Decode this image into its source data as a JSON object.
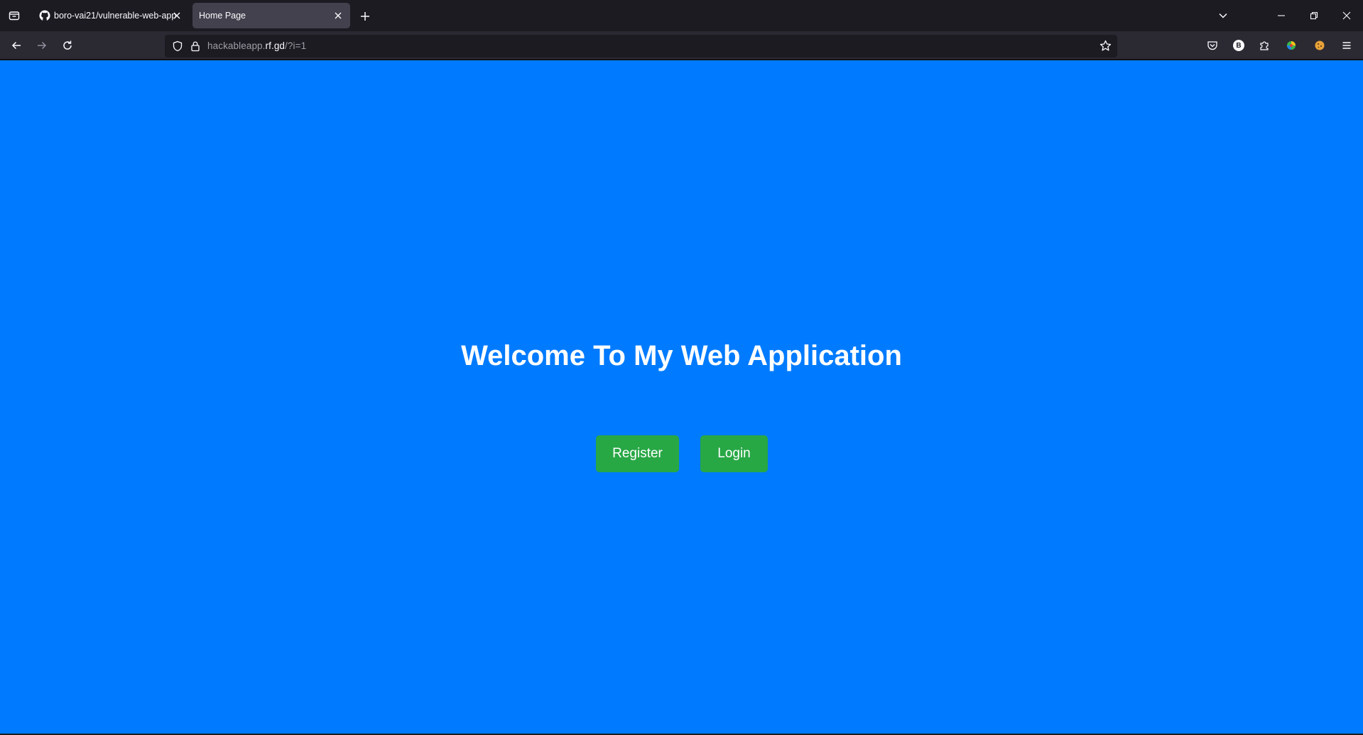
{
  "browser": {
    "tabs": [
      {
        "label": "boro-vai21/vulnerable-web-app",
        "icon": "github-icon",
        "active": false
      },
      {
        "label": "Home Page",
        "active": true
      }
    ],
    "url": {
      "prefix": "hackableapp.",
      "host": "rf.gd",
      "suffix": "/?i=1"
    },
    "extension_badge": "B"
  },
  "page": {
    "headline": "Welcome To My Web Application",
    "buttons": {
      "register": "Register",
      "login": "Login"
    },
    "colors": {
      "background": "#007bff",
      "button": "#28a745"
    }
  }
}
